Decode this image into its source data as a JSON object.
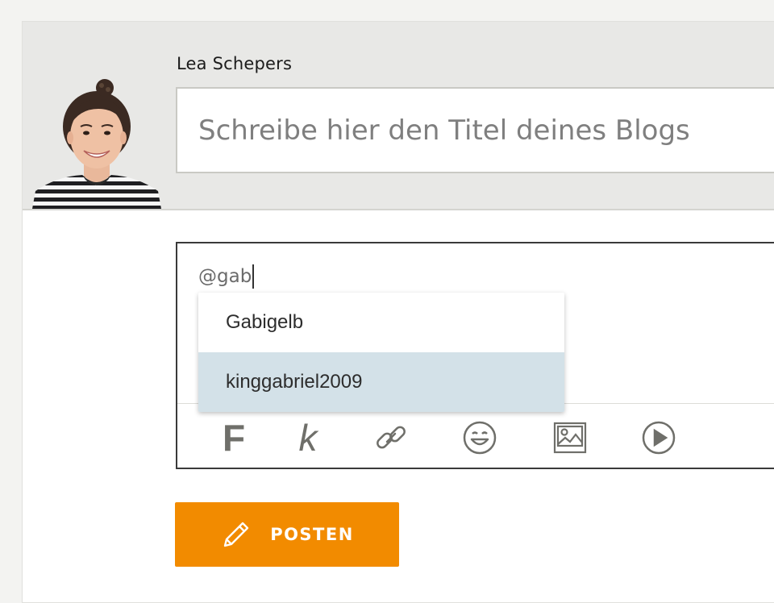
{
  "author": {
    "name": "Lea Schepers"
  },
  "title_field": {
    "placeholder": "Schreibe hier den Titel deines Blogs",
    "value": ""
  },
  "editor": {
    "text": "@gab"
  },
  "mention_suggestions": [
    {
      "label": "Gabigelb",
      "highlighted": false
    },
    {
      "label": "kinggabriel2009",
      "highlighted": true
    }
  ],
  "toolbar": {
    "bold_label": "F",
    "italic_label": "k",
    "icons": [
      "link-icon",
      "emoji-icon",
      "image-icon",
      "video-play-icon"
    ]
  },
  "post_button": {
    "label": "POSTEN",
    "icon": "pencil-icon"
  },
  "colors": {
    "accent": "#f28b00",
    "highlight": "#d3e1e8",
    "header_bg": "#e8e8e6",
    "icon_gray": "#6f6f6a"
  }
}
